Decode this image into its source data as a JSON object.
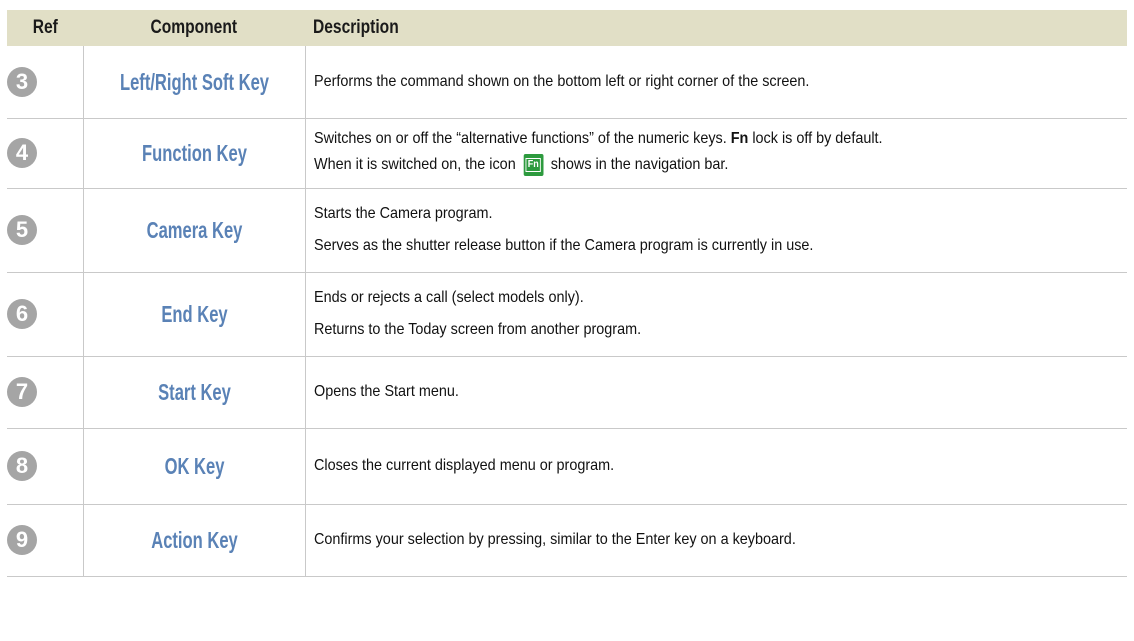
{
  "header": {
    "ref": "Ref",
    "component": "Component",
    "description": "Description"
  },
  "rows": [
    {
      "num": "3",
      "component": "Left/Right Soft Key",
      "desc": [
        "Performs the command shown on the bottom left or right corner of the screen."
      ]
    },
    {
      "num": "4",
      "component": "Function Key",
      "desc1_a": "Switches on or off the “alternative functions” of the numeric keys. ",
      "desc1_bold": "Fn",
      "desc1_b": " lock is off by default.",
      "desc2_a": "When it is switched on, the icon ",
      "icon_text": "Fn",
      "icon_name": "fn-lock-icon",
      "desc2_b": " shows in the navigation bar."
    },
    {
      "num": "5",
      "component": "Camera Key",
      "desc": [
        "Starts the Camera program.",
        "Serves as the shutter release button if the Camera program is currently in use."
      ]
    },
    {
      "num": "6",
      "component": "End Key",
      "desc": [
        "Ends or rejects a call (select models only).",
        "Returns to the Today screen from another program."
      ]
    },
    {
      "num": "7",
      "component": "Start Key",
      "desc": [
        "Opens the Start menu."
      ]
    },
    {
      "num": "8",
      "component": "OK Key",
      "desc": [
        "Closes the current displayed menu or program."
      ]
    },
    {
      "num": "9",
      "component": "Action Key",
      "desc": [
        "Confirms your selection by pressing, similar to the Enter key on a keyboard."
      ]
    }
  ],
  "colors": {
    "header_bg": "#e1dfc6",
    "component_text": "#5a82b6",
    "number_circle": "#a5a5a5",
    "fn_icon": "#2d9a3e"
  }
}
